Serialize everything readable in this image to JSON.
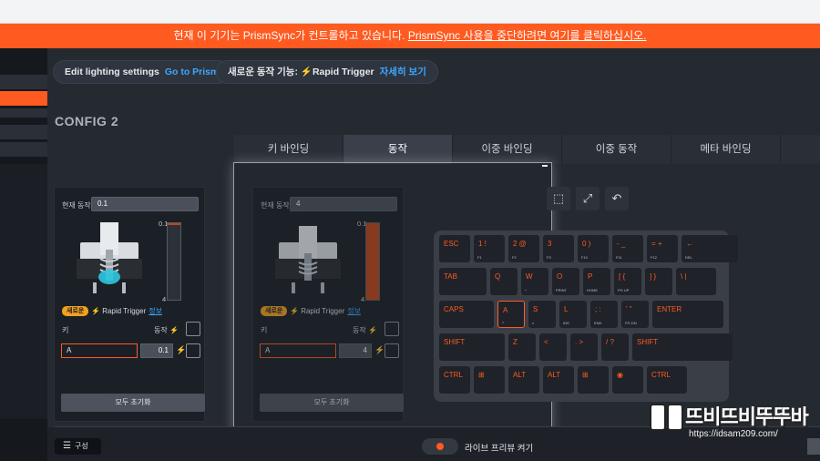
{
  "banner": {
    "text": "현재 이 기기는 PrismSync가 컨트롤하고 있습니다. ",
    "link": "PrismSync 사용을 중단하려면 여기를 클릭하십시오."
  },
  "pills": {
    "lighting_label": "Edit lighting settings",
    "lighting_link": "Go to Prism",
    "new_feature_label": "새로운 동작 기능: ",
    "new_feature_name": "Rapid Trigger",
    "new_feature_link": "자세히 보기"
  },
  "config_title": "CONFIG 2",
  "tabs": [
    "키 바인딩",
    "동작",
    "이중 바인딩",
    "이중 동작",
    "메타 바인딩"
  ],
  "active_tab": 1,
  "panels": [
    {
      "current_label": "현재 동작:",
      "current_value": "0.1",
      "gauge_top": "0.1",
      "gauge_bottom": "4",
      "gauge_level": 0.02,
      "badge": "새로운",
      "rt_name": "Rapid Trigger",
      "rt_link": "정보",
      "hdr_key": "키",
      "hdr_action": "동작",
      "key_value": "A",
      "action_value": "0.1",
      "reset_label": "모두 초기화"
    },
    {
      "current_label": "현재 동작:",
      "current_value": "4",
      "gauge_top": "0.1",
      "gauge_bottom": "4",
      "gauge_level": 1.0,
      "badge": "새로운",
      "rt_name": "Rapid Trigger",
      "rt_link": "정보",
      "hdr_key": "키",
      "hdr_action": "동작",
      "key_value": "A",
      "action_value": "4",
      "reset_label": "모두 초기화"
    }
  ],
  "keyboard": {
    "selected_key": "A",
    "rows": [
      [
        {
          "p": "ESC",
          "s": ""
        },
        {
          "p": "1  !",
          "s": "F1"
        },
        {
          "p": "2 @",
          "s": "F2"
        },
        {
          "p": "3",
          "s": "F3"
        },
        {
          "p": "0  )",
          "s": "F10"
        },
        {
          "p": "-  _",
          "s": "F11"
        },
        {
          "p": "=  +",
          "s": "F12"
        },
        {
          "p": "←",
          "s": "DEL"
        }
      ],
      [
        {
          "p": "TAB",
          "s": ""
        },
        {
          "p": "Q",
          "s": ""
        },
        {
          "p": "W",
          "s": "^"
        },
        {
          "p": "O",
          "s": "PRINT"
        },
        {
          "p": "P",
          "s": "HOME"
        },
        {
          "p": "[  {",
          "s": "PG UP"
        },
        {
          "p": "]  }",
          "s": ""
        },
        {
          "p": "\\  |",
          "s": ""
        }
      ],
      [
        {
          "p": "CAPS",
          "s": ""
        },
        {
          "p": "A",
          "s": "<"
        },
        {
          "p": "S",
          "s": "v"
        },
        {
          "p": "L",
          "s": "INS"
        },
        {
          "p": ";  :",
          "s": "END"
        },
        {
          "p": "'  \"",
          "s": "PG DN"
        },
        {
          "p": "ENTER",
          "s": ""
        }
      ],
      [
        {
          "p": "SHIFT",
          "s": ""
        },
        {
          "p": "Z",
          "s": ""
        },
        {
          "p": "<",
          "s": ""
        },
        {
          "p": ".  >",
          "s": ""
        },
        {
          "p": "/  ?",
          "s": ""
        },
        {
          "p": "SHIFT",
          "s": ""
        }
      ],
      [
        {
          "p": "CTRL",
          "s": ""
        },
        {
          "p": "⊞",
          "s": ""
        },
        {
          "p": "ALT",
          "s": ""
        },
        {
          "p": "ALT",
          "s": ""
        },
        {
          "p": "⊞",
          "s": ""
        },
        {
          "p": "◉",
          "s": ""
        },
        {
          "p": "CTRL",
          "s": ""
        }
      ]
    ]
  },
  "bottom": {
    "config_button": "구성",
    "live_preview": "라이브 프리뷰 켜기"
  },
  "watermark": {
    "main": "뜨비뜨비뚜뚜바",
    "url": "https://idsam209.com/"
  },
  "colors": {
    "accent": "#ff5a1f",
    "link": "#3fa6ff",
    "badge": "#f2a01f"
  }
}
